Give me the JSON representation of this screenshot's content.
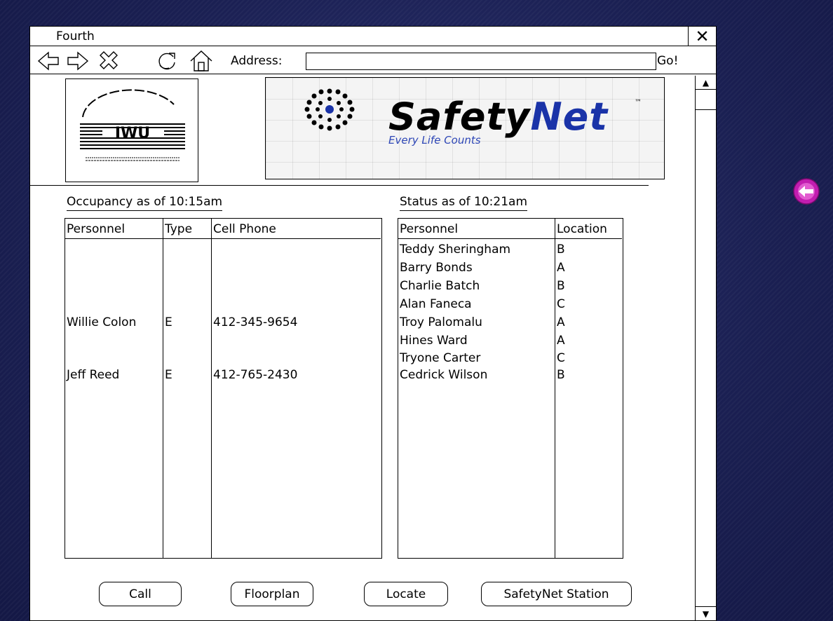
{
  "window": {
    "title": "Fourth"
  },
  "toolbar": {
    "nav_icons": [
      "back-arrow-icon",
      "forward-arrow-icon",
      "stop-icon",
      "refresh-icon",
      "home-icon"
    ],
    "address_label": "Address:",
    "address_value": "",
    "go_label": "Go!"
  },
  "logos": {
    "left_logo": "IWU",
    "brand_safety": "Safety",
    "brand_net": "Net",
    "trademark": "™",
    "tagline": "Every Life Counts"
  },
  "occupancy": {
    "heading": "Occupancy as of 10:15am",
    "columns": [
      "Personnel",
      "Type",
      "Cell Phone"
    ],
    "rows": [
      {
        "personnel": "Willie Colon",
        "type": "E",
        "cell_phone": "412-345-9654"
      },
      {
        "personnel": "Jeff Reed",
        "type": "E",
        "cell_phone": "412-765-2430"
      }
    ]
  },
  "status": {
    "heading": "Status as of 10:21am",
    "columns": [
      "Personnel",
      "Location"
    ],
    "rows": [
      {
        "personnel": "Teddy Sheringham",
        "location": "B"
      },
      {
        "personnel": "Barry Bonds",
        "location": "A"
      },
      {
        "personnel": "Charlie Batch",
        "location": "B"
      },
      {
        "personnel": "Alan Faneca",
        "location": "C"
      },
      {
        "personnel": "Troy Palomalu",
        "location": "A"
      },
      {
        "personnel": "Hines Ward",
        "location": "A"
      },
      {
        "personnel": "Tryone Carter",
        "location": "C"
      },
      {
        "personnel": "Cedrick Wilson",
        "location": "B"
      }
    ]
  },
  "buttons": {
    "call": "Call",
    "floorplan": "Floorplan",
    "locate": "Locate",
    "station": "SafetyNet Station"
  },
  "colors": {
    "background": "#1c2158",
    "brand_blue": "#1a33a8",
    "back_button": "#c21db0"
  }
}
